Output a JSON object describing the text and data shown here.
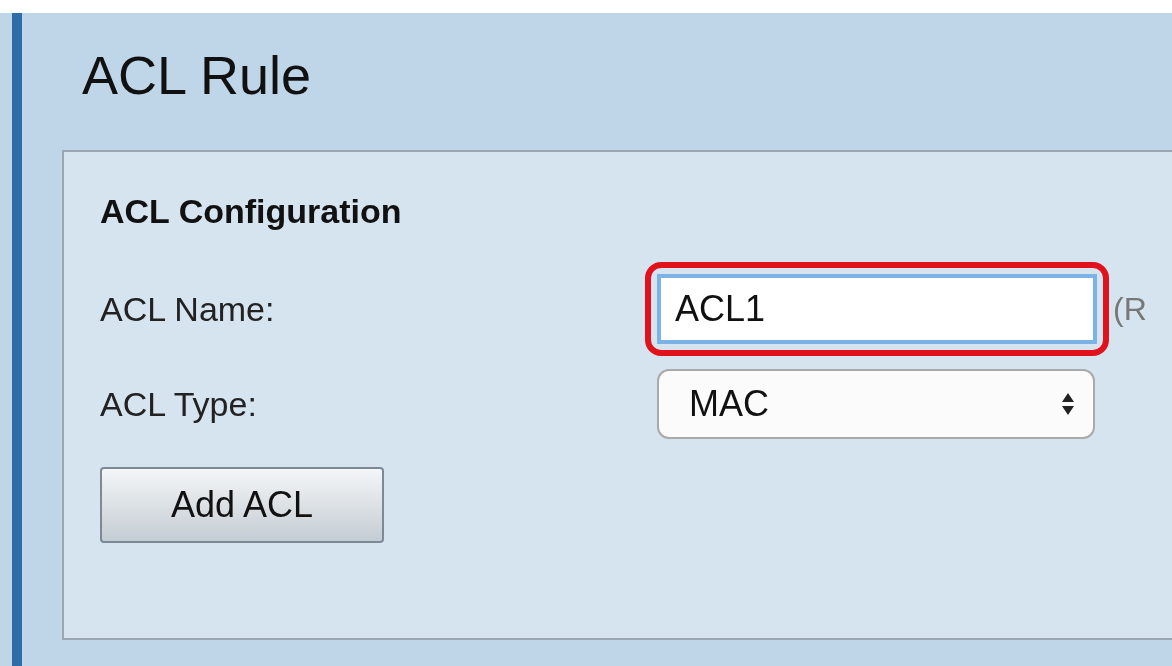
{
  "page": {
    "title": "ACL Rule"
  },
  "panel": {
    "heading": "ACL Configuration",
    "fields": [
      {
        "kind": "text",
        "label": "ACL Name:",
        "value": "ACL1",
        "highlighted": true,
        "note": "(R"
      },
      {
        "kind": "select",
        "label": "ACL Type:",
        "value": "MAC",
        "highlighted": false
      }
    ],
    "buttons": [
      "Add ACL"
    ]
  }
}
